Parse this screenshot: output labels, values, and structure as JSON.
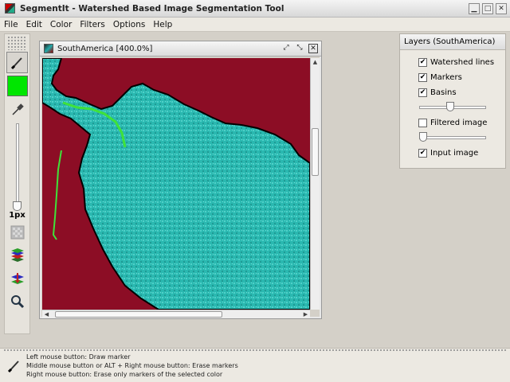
{
  "window": {
    "title": "SegmentIt - Watershed Based Image Segmentation Tool",
    "app_icon": "segmentit-app-icon",
    "controls": [
      "minimize-icon",
      "maximize-icon",
      "close-icon"
    ]
  },
  "menu": {
    "items": [
      "File",
      "Edit",
      "Color",
      "Filters",
      "Options",
      "Help"
    ]
  },
  "toolbar": {
    "tools": [
      "brush-icon",
      "color-picker",
      "eyedropper-icon",
      "brush-size-slider",
      "filter-icon",
      "layers-icon",
      "layer-down-icon",
      "zoom-icon"
    ],
    "color": "#00e600",
    "brush_size_label": "1px"
  },
  "image_window": {
    "title": "SouthAmerica [400.0%]",
    "controls": [
      "detach-icon",
      "maximize-icon",
      "close-icon"
    ],
    "colors": {
      "basin": "#2ab8b0",
      "background": "#8c0d25",
      "marker": "#3fe23a",
      "watershed": "#000000"
    }
  },
  "layers_panel": {
    "title": "Layers (SouthAmerica)",
    "items": [
      {
        "label": "Watershed lines",
        "checked": true
      },
      {
        "label": "Markers",
        "checked": true
      },
      {
        "label": "Basins",
        "checked": true
      },
      {
        "label": "Filtered image",
        "checked": false
      },
      {
        "label": "Input image",
        "checked": true
      }
    ],
    "basins_opacity": 0.5,
    "filtered_opacity": 0.0
  },
  "status": {
    "icon": "brush-icon",
    "lines": [
      "Left mouse button: Draw marker",
      "Middle mouse button or ALT + Right mouse button: Erase markers",
      "Right mouse button: Erase only markers of the selected color"
    ]
  }
}
